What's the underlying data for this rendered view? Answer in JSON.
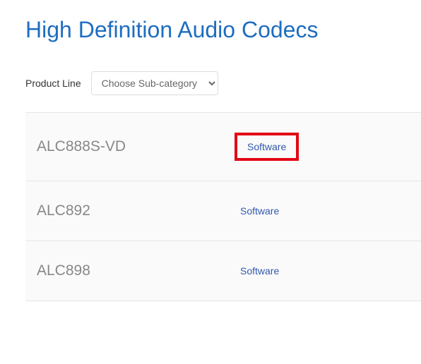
{
  "title": "High Definition Audio Codecs",
  "filter": {
    "label": "Product Line",
    "placeholder": "Choose Sub-category"
  },
  "products": [
    {
      "name": "ALC888S-VD",
      "link_label": "Software",
      "highlighted": true
    },
    {
      "name": "ALC892",
      "link_label": "Software",
      "highlighted": false
    },
    {
      "name": "ALC898",
      "link_label": "Software",
      "highlighted": false
    }
  ]
}
